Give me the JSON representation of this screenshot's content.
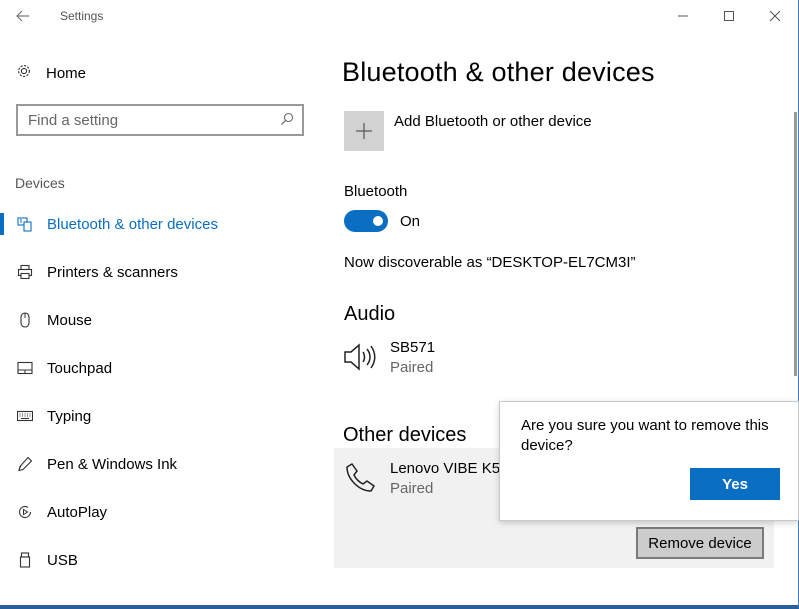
{
  "window": {
    "title": "Settings",
    "controls": {
      "back": "back-arrow-icon",
      "minimize": "minimize-icon",
      "maximize": "maximize-icon",
      "close": "close-icon"
    }
  },
  "sidebar": {
    "home_label": "Home",
    "search_placeholder": "Find a setting",
    "section_label": "Devices",
    "items": [
      {
        "label": "Bluetooth & other devices",
        "icon": "bluetooth-devices-icon",
        "active": true
      },
      {
        "label": "Printers & scanners",
        "icon": "printer-icon",
        "active": false
      },
      {
        "label": "Mouse",
        "icon": "mouse-icon",
        "active": false
      },
      {
        "label": "Touchpad",
        "icon": "touchpad-icon",
        "active": false
      },
      {
        "label": "Typing",
        "icon": "keyboard-icon",
        "active": false
      },
      {
        "label": "Pen & Windows Ink",
        "icon": "pen-icon",
        "active": false
      },
      {
        "label": "AutoPlay",
        "icon": "autoplay-icon",
        "active": false
      },
      {
        "label": "USB",
        "icon": "usb-icon",
        "active": false
      }
    ]
  },
  "main": {
    "title": "Bluetooth & other devices",
    "add_device_label": "Add Bluetooth or other device",
    "bluetooth_label": "Bluetooth",
    "bluetooth_state": "On",
    "discoverable_text": "Now discoverable as “DESKTOP-EL7CM3I”",
    "audio_heading": "Audio",
    "audio_device": {
      "name": "SB571",
      "status": "Paired",
      "icon": "speaker-icon"
    },
    "other_heading": "Other devices",
    "other_device": {
      "name": "Lenovo VIBE K5",
      "status": "Paired",
      "icon": "phone-icon"
    },
    "remove_button": "Remove device"
  },
  "confirm": {
    "message": "Are you sure you want to remove this device?",
    "yes_button": "Yes"
  },
  "colors": {
    "accent": "#0a6fc2",
    "tile": "#d2d2d2",
    "panel": "#f1f1f1"
  }
}
